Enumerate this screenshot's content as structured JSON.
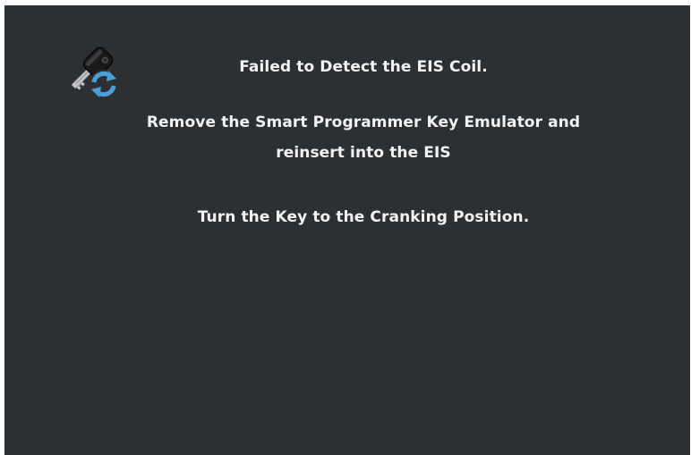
{
  "dialog": {
    "icon": "key-refresh-icon",
    "title": "Failed to Detect the EIS Coil.",
    "remove_line_1": "Remove the Smart Programmer Key Emulator and",
    "remove_line_2": "reinsert into the EIS",
    "instruction": "Turn the Key to the Cranking Position."
  },
  "colors": {
    "background": "#2d3032",
    "text": "#f2f2f2",
    "refresh_arrows": "#4a9fd8",
    "key_body": "#1a1a1a",
    "key_blade": "#c8c8c8"
  }
}
